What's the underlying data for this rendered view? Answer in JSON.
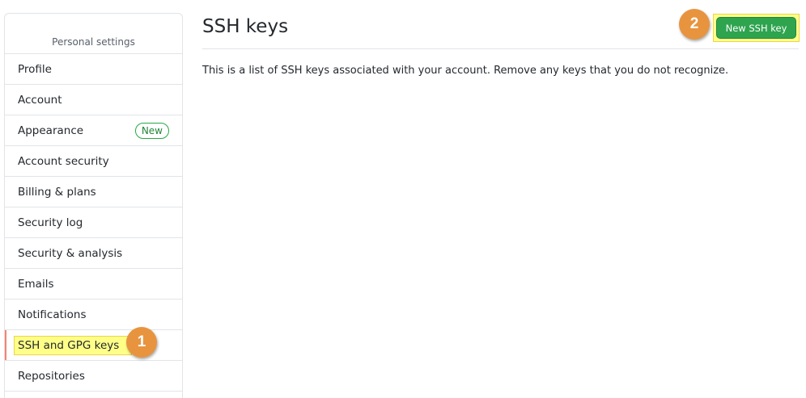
{
  "sidebar": {
    "header": "Personal settings",
    "items": [
      {
        "label": "Profile"
      },
      {
        "label": "Account"
      },
      {
        "label": "Appearance",
        "badge": "New"
      },
      {
        "label": "Account security"
      },
      {
        "label": "Billing & plans"
      },
      {
        "label": "Security log"
      },
      {
        "label": "Security & analysis"
      },
      {
        "label": "Emails"
      },
      {
        "label": "Notifications"
      },
      {
        "label": "SSH and GPG keys",
        "selected": true
      },
      {
        "label": "Repositories"
      }
    ]
  },
  "main": {
    "title": "SSH keys",
    "description": "This is a list of SSH keys associated with your account. Remove any keys that you do not recognize.",
    "new_key_button": "New SSH key"
  },
  "callouts": {
    "step1": "1",
    "step2": "2"
  },
  "colors": {
    "accent_selected": "#f9826c",
    "button_green": "#2ea44f",
    "highlight_yellow": "#ffff88",
    "callout_orange": "#e8943f"
  }
}
